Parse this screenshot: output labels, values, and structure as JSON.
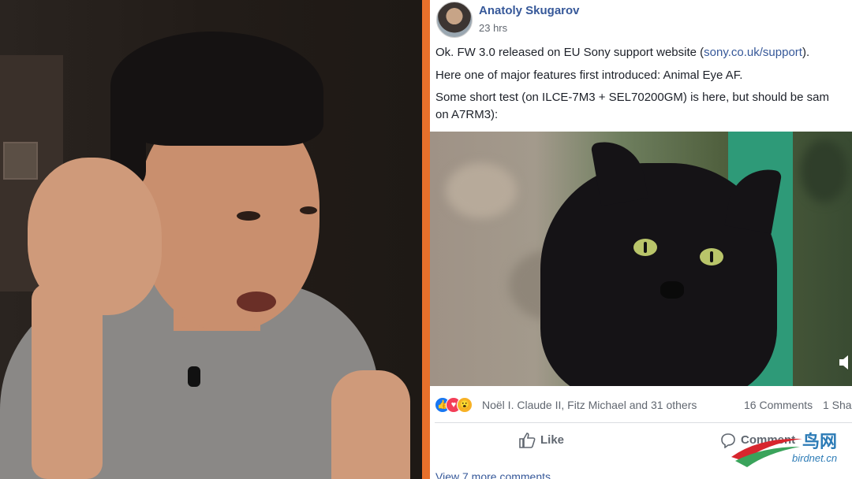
{
  "post": {
    "author": "Anatoly Skugarov",
    "time": "23 hrs",
    "line1_text": "Ok. FW 3.0 released on EU Sony support website (",
    "line1_link": "sony.co.uk/support",
    "line1_end": ").",
    "line2": "Here one of major features first introduced: Animal Eye AF.",
    "line3": "Some short test (on ILCE-7M3 + SEL70200GM) is here, but should be sam",
    "line4": "on A7RM3):"
  },
  "reactions": {
    "names": "Noël I. Claude II, Fitz Michael and 31 others",
    "comments": "16 Comments",
    "shares": "1 Sha"
  },
  "actions": {
    "like": "Like",
    "comment": "Comment"
  },
  "footer": {
    "more_comments": "View 7 more comments"
  },
  "watermark": {
    "cn": "鸟网",
    "en": "birdnet.cn"
  },
  "colors": {
    "accent": "#e7702b",
    "link": "#365899"
  }
}
